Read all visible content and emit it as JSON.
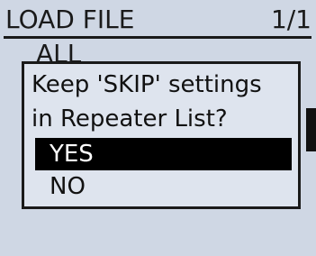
{
  "header": {
    "title": "LOAD FILE",
    "page": "1/1"
  },
  "background_list": {
    "first_item": "ALL"
  },
  "dialog": {
    "message_line1": "Keep 'SKIP' settings",
    "message_line2": "in Repeater List?",
    "options": [
      {
        "label": "YES",
        "selected": true
      },
      {
        "label": "NO",
        "selected": false
      }
    ]
  },
  "colors": {
    "lcd_background": "#cfd7e4",
    "dialog_background": "#dee4ee",
    "text": "#1a1a1a",
    "selection": "#000000"
  }
}
